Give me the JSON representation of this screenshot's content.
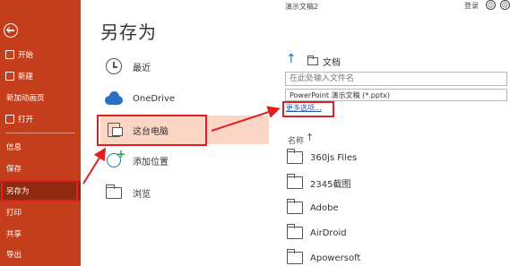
{
  "nav": {
    "items": [
      {
        "label": "开始",
        "icon": "home-icon"
      },
      {
        "label": "新建",
        "icon": "new-document-icon"
      },
      {
        "label": "新加动画页"
      },
      {
        "label": "打开",
        "icon": "open-folder-icon"
      },
      {
        "label": "信息"
      },
      {
        "label": "保存"
      },
      {
        "label": "另存为"
      },
      {
        "label": "打印"
      },
      {
        "label": "共享"
      },
      {
        "label": "导出"
      }
    ],
    "accent": "#c43e1c"
  },
  "page": {
    "title": "另存为"
  },
  "locations": [
    {
      "label": "最近",
      "icon": "clock-icon"
    },
    {
      "label": "OneDrive",
      "icon": "onedrive-cloud-icon"
    },
    {
      "label": "这台电脑",
      "icon": "this-pc-icon"
    },
    {
      "label": "添加位置",
      "icon": "add-location-icon"
    },
    {
      "label": "浏览",
      "icon": "browse-folder-icon"
    }
  ],
  "window": {
    "doc_title": "演示文稿2",
    "signin": "登录"
  },
  "save": {
    "path_label": "文档",
    "filename_placeholder": "在此处输入文件名",
    "file_type": "PowerPoint 演示文稿 (*.pptx)",
    "more_options": "更多选项..."
  },
  "files": {
    "column_header": "名称",
    "items": [
      "360js Files",
      "2345截图",
      "Adobe",
      "AirDroid",
      "Apowersoft"
    ]
  },
  "colors": {
    "annotation": "#e02020",
    "selected_bg": "#fbd6c4"
  }
}
